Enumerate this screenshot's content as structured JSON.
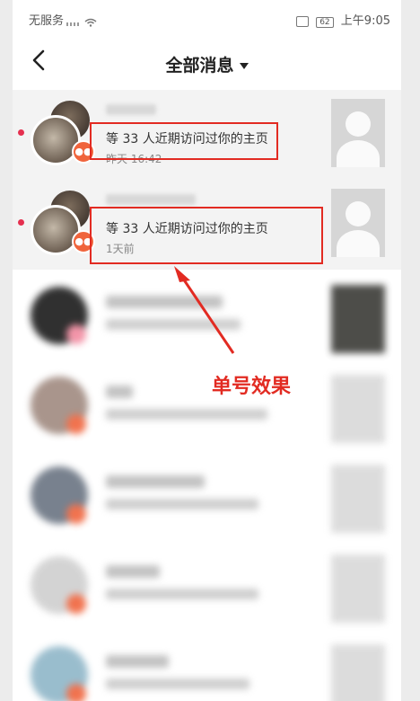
{
  "status_bar": {
    "carrier": "无服务",
    "battery": "62",
    "time": "上午9:05"
  },
  "header": {
    "title": "全部消息"
  },
  "messages": [
    {
      "text": "等 33 人近期访问过你的主页",
      "time": "昨天 16:42",
      "unread": true
    },
    {
      "text": "等 33 人近期访问过你的主页",
      "time": "1天前",
      "unread": true
    }
  ],
  "annotation": {
    "label": "单号效果",
    "color": "#e22b22"
  },
  "colors": {
    "badge": "#f0643c",
    "unread_dot": "#e5304f",
    "highlight_box": "#e22b22"
  }
}
